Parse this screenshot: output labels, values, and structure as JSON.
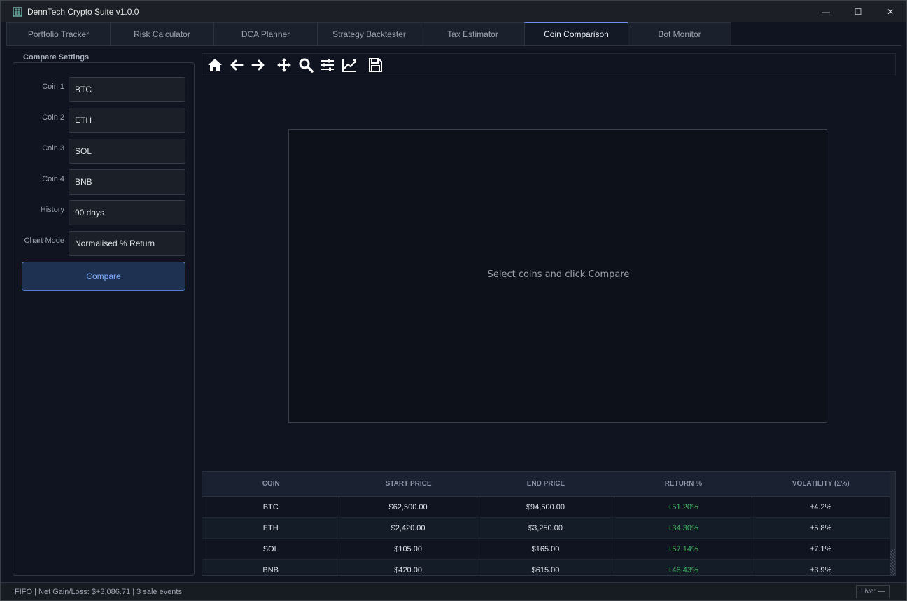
{
  "app": {
    "title": "DennTech Crypto Suite  v1.0.0"
  },
  "window_controls": {
    "minimize": "—",
    "maximize": "☐",
    "close": "✕"
  },
  "tabs": [
    {
      "label": "Portfolio Tracker"
    },
    {
      "label": "Risk Calculator"
    },
    {
      "label": "DCA Planner"
    },
    {
      "label": "Strategy Backtester"
    },
    {
      "label": "Tax Estimator"
    },
    {
      "label": "Coin Comparison",
      "active": true
    },
    {
      "label": "Bot Monitor"
    }
  ],
  "settings": {
    "title": "Compare Settings",
    "fields": [
      {
        "label": "Coin 1",
        "value": "BTC"
      },
      {
        "label": "Coin 2",
        "value": "ETH"
      },
      {
        "label": "Coin 3",
        "value": "SOL"
      },
      {
        "label": "Coin 4",
        "value": "BNB"
      },
      {
        "label": "History",
        "value": "90 days"
      },
      {
        "label": "Chart Mode",
        "value": "Normalised % Return"
      }
    ],
    "compare_label": "Compare"
  },
  "toolbar": {
    "icons": [
      "home-icon",
      "back-arrow-icon",
      "forward-arrow-icon",
      "pan-icon",
      "zoom-icon",
      "configure-subplots-icon",
      "edit-axes-icon",
      "save-icon"
    ]
  },
  "plot": {
    "placeholder": "Select coins and click Compare"
  },
  "table": {
    "headers": [
      "COIN",
      "START PRICE",
      "END PRICE",
      "RETURN %",
      "VOLATILITY (Σ%)"
    ],
    "rows": [
      [
        "BTC",
        "$62,500.00",
        "$94,500.00",
        "+51.20%",
        "±4.2%"
      ],
      [
        "ETH",
        "$2,420.00",
        "$3,250.00",
        "+34.30%",
        "±5.8%"
      ],
      [
        "SOL",
        "$105.00",
        "$165.00",
        "+57.14%",
        "±7.1%"
      ],
      [
        "BNB",
        "$420.00",
        "$615.00",
        "+46.43%",
        "±3.9%"
      ]
    ]
  },
  "status": {
    "text": "FIFO  |  Net Gain/Loss: $+3,086.71  |  3 sale events",
    "live": "Live: —"
  },
  "colors": {
    "accent": "#4f7ed6",
    "positive": "#3fb55f",
    "background": "#0f1420"
  }
}
